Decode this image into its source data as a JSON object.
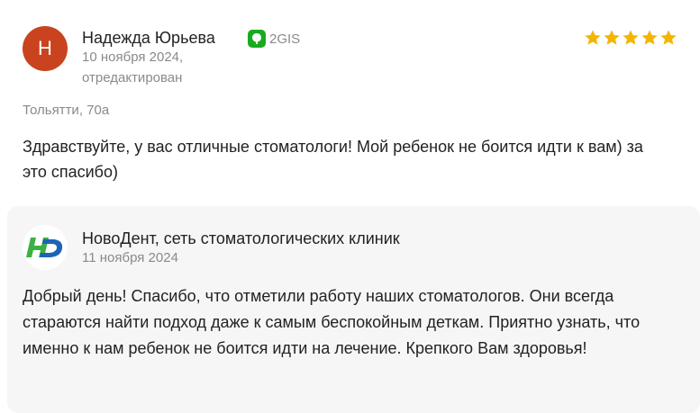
{
  "review": {
    "author": {
      "initial": "Н",
      "name": "Надежда Юрьева",
      "avatar_color": "#c9431e"
    },
    "source": {
      "icon": "2gis-logo-icon",
      "name": "2GIS",
      "color": "#19aa1e"
    },
    "date": "10 ноября 2024,",
    "edited": "отредактирован",
    "rating": 5,
    "star_color": "#f5b400",
    "location": "Тольятти, 70а",
    "text": "Здравствуйте, у вас отличные стоматологи! Мой ребенок не боится идти к вам) за это спасибо)"
  },
  "reply": {
    "logo_icon": "novodent-logo-icon",
    "name": "НовоДент, сеть стоматологических клиник",
    "date": "11 ноября 2024",
    "text": "Добрый день! Спасибо, что отметили работу наших стоматологов. Они всегда стараются найти подход даже к самым беспокойным деткам. Приятно узнать, что именно к нам ребенок не боится идти на лечение. Крепкого Вам здоровья!"
  }
}
